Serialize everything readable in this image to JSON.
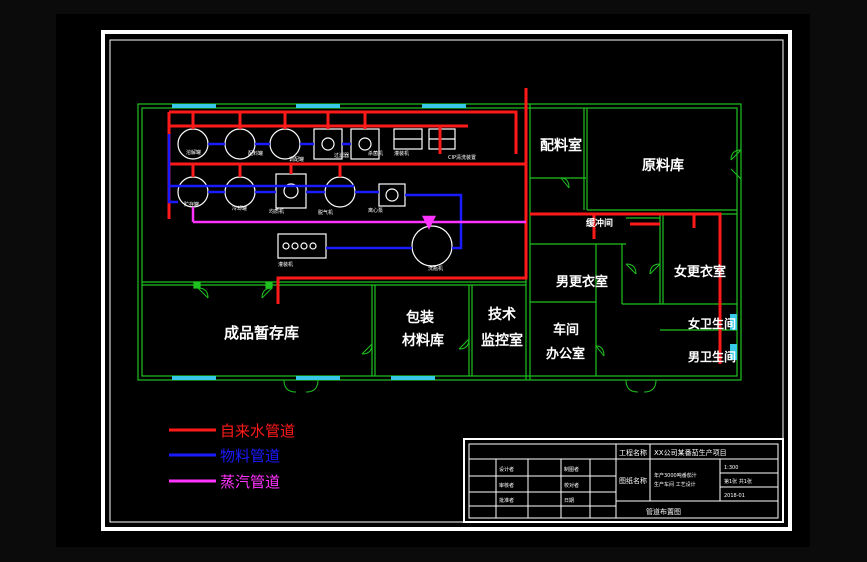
{
  "colors": {
    "frame": "#ffffff",
    "wall": "#1fc21f",
    "water": "#ff1a1a",
    "material": "#1a1aff",
    "steam": "#ff33ff",
    "window": "#38c8e8",
    "equipment": "#ffffff"
  },
  "rooms": {
    "batching": "配料室",
    "raw_material": "原料库",
    "male_changing": "男更衣室",
    "female_changing": "女更衣室",
    "toilet_f": "女卫生间",
    "toilet_m": "男卫生间",
    "finished_storage": "成品暂存库",
    "packaging_line1": "包装",
    "packaging_line2": "材料库",
    "tech_line1": "技术",
    "tech_line2": "监控室",
    "workshop_line1": "车间",
    "workshop_line2": "办公室",
    "corridor": "缓冲间"
  },
  "equipment_labels": [
    "溶解罐",
    "配料罐",
    "调配罐",
    "过滤器",
    "杀菌机",
    "灌装机",
    "贮存罐",
    "冷却罐",
    "均质机",
    "脱气机",
    "洗瓶机",
    "CIP清洗装置",
    "蒸汽锅炉",
    "离心泵"
  ],
  "legend": [
    {
      "label": "自来水管道",
      "color": "#ff1a1a"
    },
    {
      "label": "物料管道",
      "color": "#1a1aff"
    },
    {
      "label": "蒸汽管道",
      "color": "#ff33ff"
    }
  ],
  "title_block": {
    "project_label": "工程名称",
    "project_value": "XX公司某番茄生产项目",
    "drawing_label": "图纸名称",
    "drawing_value_line1": "年产3000吨番茄汁",
    "drawing_value_line2": "生产车间 工艺设计",
    "scale": "1:300",
    "sheet": "第1张 共1张",
    "date": "2018-01",
    "drawing_title": "管道布置图",
    "sign_left": [
      "设计者",
      "审核者",
      "批准者"
    ],
    "sign_mid": [
      "制图者",
      "校对者",
      "日期"
    ]
  }
}
